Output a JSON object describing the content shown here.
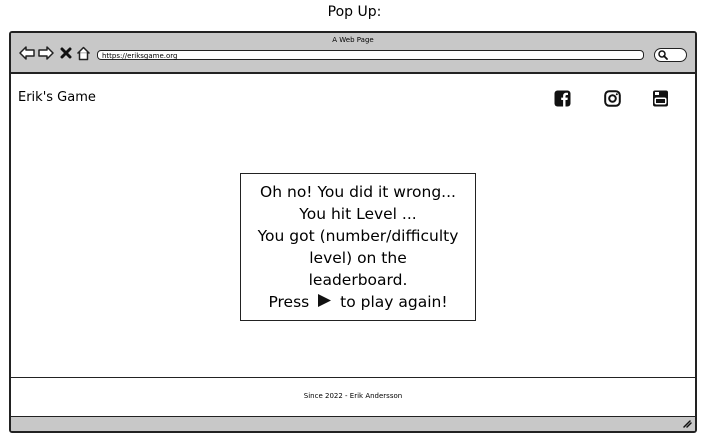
{
  "caption": "Pop Up:",
  "browser": {
    "title": "A Web Page",
    "url": "https://eriksgame.org",
    "nav_icons": [
      "back-arrow-icon",
      "forward-arrow-icon",
      "close-x-icon",
      "home-icon"
    ],
    "search_icon": "search-icon"
  },
  "header": {
    "site_title": "Erik's Game",
    "social": [
      "facebook-icon",
      "instagram-icon",
      "youtube-icon"
    ]
  },
  "popup": {
    "line1": "Oh no! You did it wrong...",
    "line2": "You hit Level ...",
    "line3": "You got (number/difficulty",
    "line4": "level) on the",
    "line5": "leaderboard.",
    "line6_before": "Press",
    "line6_after": "to play again!",
    "play_icon": "play-icon"
  },
  "footer": {
    "text": "Since 2022 - Erik Andersson"
  }
}
